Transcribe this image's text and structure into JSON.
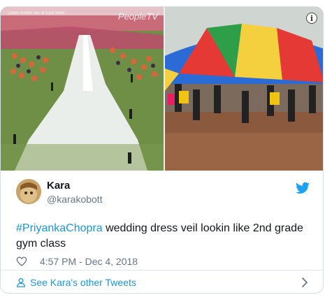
{
  "tweet": {
    "author_name": "Kara",
    "author_handle": "@karakobott",
    "hashtag": "#PriyankaChopra",
    "text_rest": " wedding dress veil lookin like 2nd grade gym class",
    "timestamp": "4:57 PM - Dec 4, 2018",
    "footer_link": "See Kara's other Tweets",
    "info_label": "i"
  },
  "media": {
    "left_watermark": "PeopleTV",
    "left_caption": "Celeb Insider live of East West"
  },
  "colors": {
    "link_blue": "#1b95e0",
    "text_dark": "#14171a",
    "text_muted": "#657786",
    "border": "#d6dde3"
  },
  "icons": {
    "verified_bird": "twitter-bird-icon",
    "like": "heart-outline-icon",
    "profile": "person-outline-icon",
    "navigation": "chevron-right-icon",
    "info": "info-circle-icon"
  }
}
